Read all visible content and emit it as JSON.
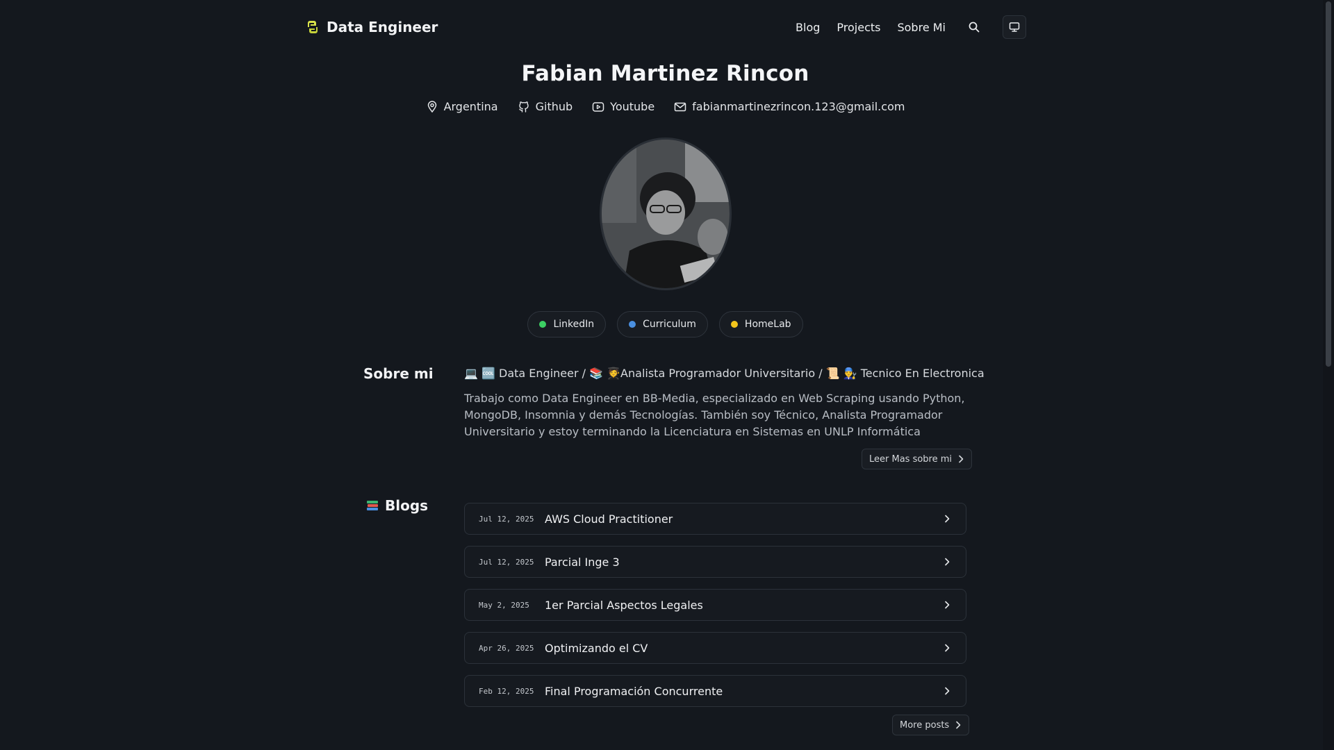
{
  "brand": {
    "name": "Data Engineer",
    "icon": "python-icon"
  },
  "nav": {
    "links": [
      "Blog",
      "Projects",
      "Sobre Mi"
    ],
    "search_icon": "search-icon",
    "theme_icon": "monitor-icon"
  },
  "profile": {
    "name": "Fabian Martinez Rincon",
    "contacts": [
      {
        "icon": "location-icon",
        "label": "Argentina"
      },
      {
        "icon": "github-icon",
        "label": "Github"
      },
      {
        "icon": "youtube-icon",
        "label": "Youtube"
      },
      {
        "icon": "mail-icon",
        "label": "fabianmartinezrincon.123@gmail.com"
      }
    ],
    "pills": [
      {
        "label": "LinkedIn",
        "color": "#3ccf63"
      },
      {
        "label": "Curriculum",
        "color": "#4a8fe0"
      },
      {
        "label": "HomeLab",
        "color": "#f2c51c"
      }
    ]
  },
  "about": {
    "title": "Sobre mi",
    "tagline": "💻 🆒 Data Engineer / 📚 🧑‍🎓Analista Programador Universitario / 📜 👨‍🔧 Tecnico En Electronica",
    "text": "Trabajo como Data Engineer en BB-Media, especializado en Web Scraping usando Python, MongoDB, Insomnia y demás Tecnologías. También soy Técnico, Analista Programador Universitario y estoy terminando la Licenciatura en Sistemas en UNLP Informática",
    "more_button": "Leer Mas sobre mi"
  },
  "blogs": {
    "title": "Blogs",
    "icon": "books-icon",
    "posts": [
      {
        "date": "Jul 12, 2025",
        "title": "AWS Cloud Practitioner"
      },
      {
        "date": "Jul 12, 2025",
        "title": "Parcial Inge 3"
      },
      {
        "date": "May 2, 2025",
        "title": "1er Parcial Aspectos Legales"
      },
      {
        "date": "Apr 26, 2025",
        "title": "Optimizando el CV"
      },
      {
        "date": "Feb 12, 2025",
        "title": "Final Programación Concurrente"
      }
    ],
    "more_button": "More posts"
  }
}
